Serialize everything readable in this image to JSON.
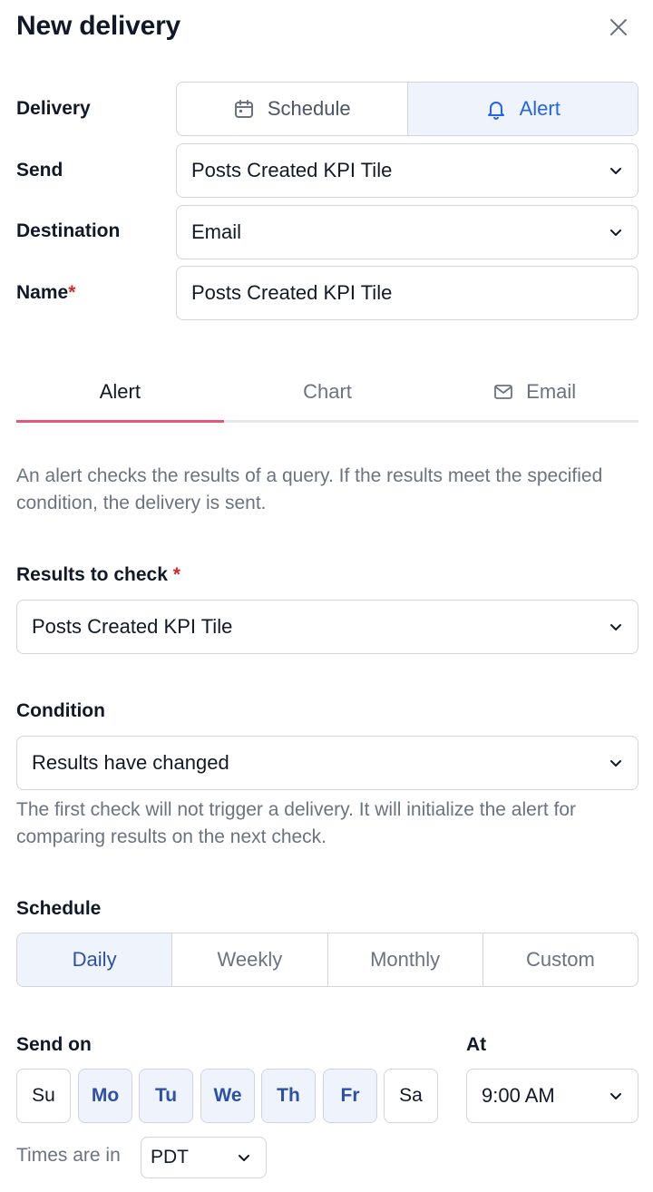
{
  "dialog": {
    "title": "New delivery",
    "close_icon": "close-icon"
  },
  "form": {
    "delivery": {
      "label": "Delivery",
      "options": [
        {
          "label": "Schedule",
          "icon": "calendar-icon",
          "active": false
        },
        {
          "label": "Alert",
          "icon": "bell-icon",
          "active": true
        }
      ]
    },
    "send": {
      "label": "Send",
      "value": "Posts Created KPI Tile"
    },
    "destination": {
      "label": "Destination",
      "value": "Email"
    },
    "name": {
      "label": "Name",
      "required_mark": "*",
      "value": "Posts Created KPI Tile"
    }
  },
  "tabs": [
    {
      "label": "Alert",
      "active": true
    },
    {
      "label": "Chart",
      "active": false
    },
    {
      "label": "Email",
      "icon": "mail-icon",
      "active": false
    }
  ],
  "alert": {
    "description": "An alert checks the results of a query. If the results meet the specified condition, the delivery is sent.",
    "results_to_check": {
      "label": "Results to check",
      "required_mark": "*",
      "value": "Posts Created KPI Tile"
    },
    "condition": {
      "label": "Condition",
      "value": "Results have changed",
      "help": "The first check will not trigger a delivery. It will initialize the alert for comparing results on the next check."
    }
  },
  "schedule": {
    "label": "Schedule",
    "options": [
      {
        "label": "Daily",
        "active": true
      },
      {
        "label": "Weekly",
        "active": false
      },
      {
        "label": "Monthly",
        "active": false
      },
      {
        "label": "Custom",
        "active": false
      }
    ],
    "send_on": {
      "label": "Send on",
      "days": [
        {
          "label": "Su",
          "selected": false
        },
        {
          "label": "Mo",
          "selected": true
        },
        {
          "label": "Tu",
          "selected": true
        },
        {
          "label": "We",
          "selected": true
        },
        {
          "label": "Th",
          "selected": true
        },
        {
          "label": "Fr",
          "selected": true
        },
        {
          "label": "Sa",
          "selected": false
        }
      ]
    },
    "at": {
      "label": "At",
      "value": "9:00 AM"
    },
    "timezone": {
      "label": "Times are in",
      "value": "PDT"
    }
  },
  "colors": {
    "accent_blue": "#2563eb",
    "active_bg": "#eff4fc",
    "tab_underline": "#e8557a",
    "required": "#dc2626"
  }
}
